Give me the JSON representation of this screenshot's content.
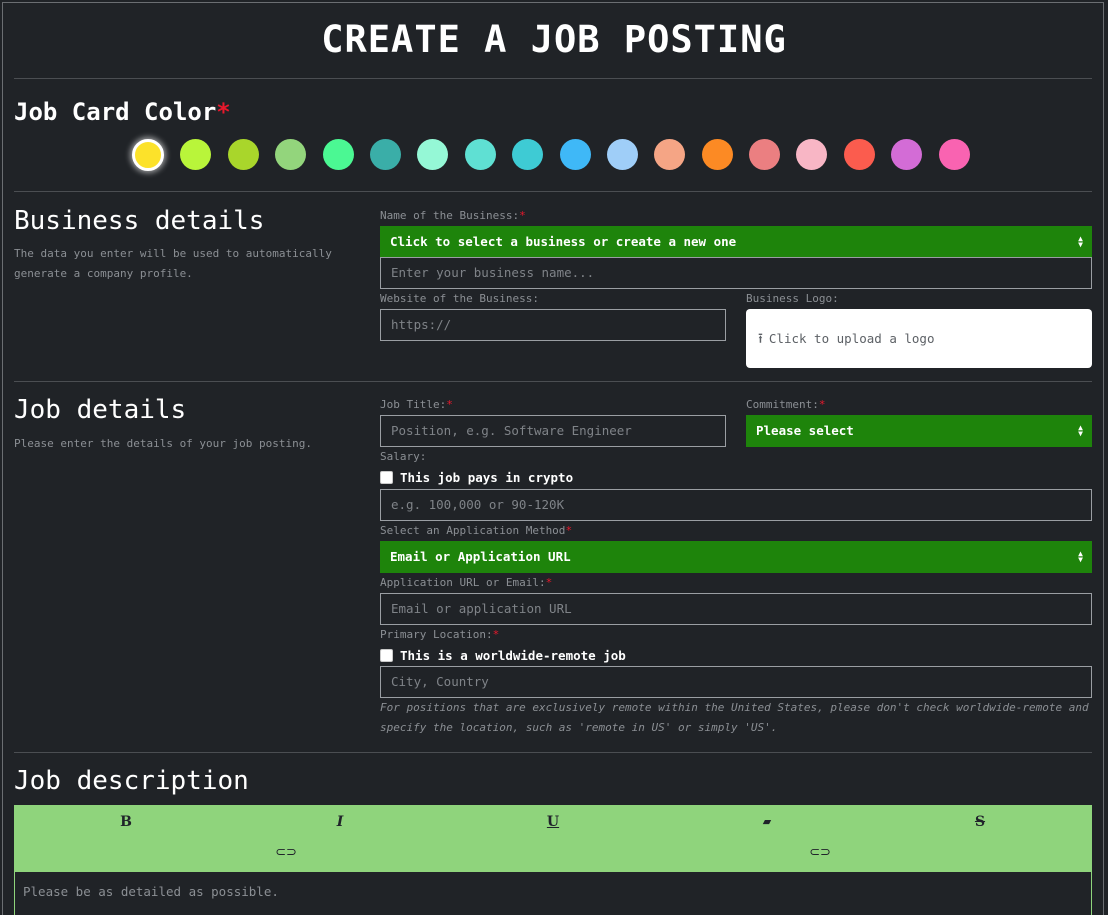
{
  "page": {
    "title": "CREATE A JOB POSTING"
  },
  "card_color": {
    "label": "Job Card Color",
    "required_mark": "*",
    "selected_index": 0,
    "swatches": [
      "#fce22a",
      "#b9f53a",
      "#a9d62b",
      "#93d57c",
      "#4bf893",
      "#3aaea8",
      "#95f8d6",
      "#5fe0d3",
      "#3ecbd4",
      "#3fb8f7",
      "#9fcef8",
      "#f5a585",
      "#fc8a24",
      "#eb7f81",
      "#f8b6c5",
      "#fb5c4e",
      "#d36cd6",
      "#f963b1"
    ]
  },
  "business": {
    "heading": "Business details",
    "description": "The data you enter will be used to automatically generate a company profile.",
    "name_label": "Name of the Business:",
    "required_mark": "*",
    "select_value": "Click to select a business or create a new one",
    "name_placeholder": "Enter your business name...",
    "website_label": "Website of the Business:",
    "website_placeholder": "https://",
    "logo_label": "Business Logo:",
    "logo_upload_text": "Click to upload a logo"
  },
  "job": {
    "heading": "Job details",
    "description": "Please enter the details of your job posting.",
    "title_label": "Job Title:",
    "title_placeholder": "Position, e.g. Software Engineer",
    "commitment_label": "Commitment:",
    "commitment_value": "Please select",
    "salary_label": "Salary:",
    "crypto_checkbox_label": "This job pays in crypto",
    "salary_placeholder": "e.g. 100,000 or 90-120K",
    "method_label": "Select an Application Method",
    "method_value": "Email or Application URL",
    "app_url_label": "Application URL or Email:",
    "app_url_placeholder": "Email or application URL",
    "location_label": "Primary Location:",
    "remote_checkbox_label": "This is a worldwide-remote job",
    "location_placeholder": "City, Country",
    "location_hint": "For positions that are exclusively remote within the United States, please don't check worldwide-remote and specify the location, such as 'remote in US' or simply 'US'.",
    "required_mark": "*"
  },
  "description": {
    "heading": "Job description",
    "toolbar": {
      "bold": "B",
      "italic": "I",
      "underline": "U",
      "clear": "⌫",
      "strike": "S",
      "link": "🔗",
      "unlink": "⛓"
    },
    "placeholder": "Please be as detailed as possible."
  },
  "icons": {
    "caret": "caret-updown-icon",
    "upload": "upload-icon"
  }
}
